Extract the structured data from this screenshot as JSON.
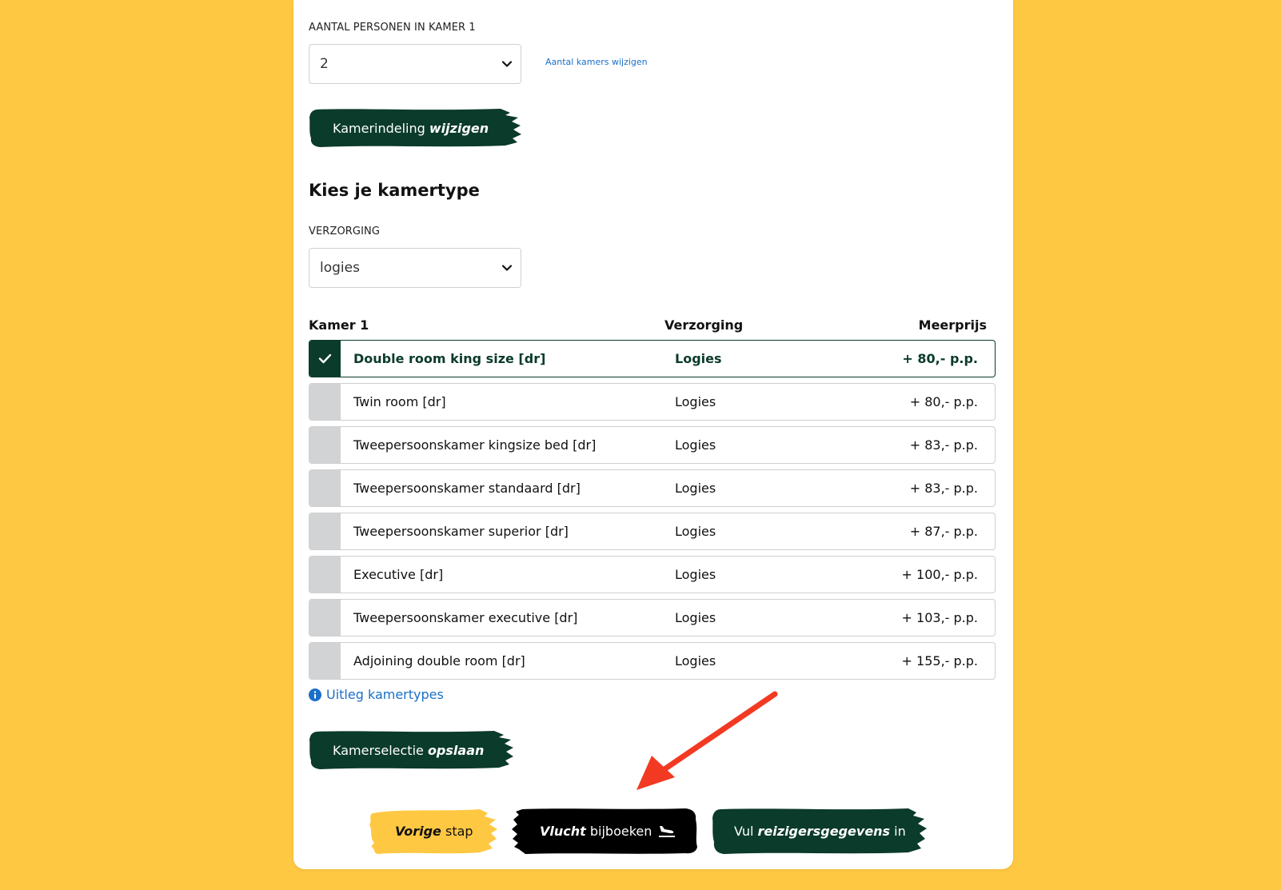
{
  "form": {
    "persons_label": "AANTAL PERSONEN IN KAMER 1",
    "persons_value": "2",
    "change_rooms_link": "Aantal kamers wijzigen",
    "layout_button_plain": "Kamerindeling ",
    "layout_button_bold": "wijzigen",
    "section_title": "Kies je kamertype",
    "care_label": "VERZORGING",
    "care_value": "logies"
  },
  "table": {
    "headers": {
      "room": "Kamer 1",
      "care": "Verzorging",
      "price": "Meerprijs"
    },
    "rows": [
      {
        "name": "Double room king size [dr]",
        "care": "Logies",
        "price": "+ 80,- p.p.",
        "selected": true
      },
      {
        "name": "Twin room [dr]",
        "care": "Logies",
        "price": "+ 80,- p.p.",
        "selected": false
      },
      {
        "name": "Tweepersoonskamer kingsize bed [dr]",
        "care": "Logies",
        "price": "+ 83,- p.p.",
        "selected": false
      },
      {
        "name": "Tweepersoonskamer standaard [dr]",
        "care": "Logies",
        "price": "+ 83,- p.p.",
        "selected": false
      },
      {
        "name": "Tweepersoonskamer superior [dr]",
        "care": "Logies",
        "price": "+ 87,- p.p.",
        "selected": false
      },
      {
        "name": "Executive [dr]",
        "care": "Logies",
        "price": "+ 100,- p.p.",
        "selected": false
      },
      {
        "name": "Tweepersoonskamer executive [dr]",
        "care": "Logies",
        "price": "+ 103,- p.p.",
        "selected": false
      },
      {
        "name": "Adjoining double room [dr]",
        "care": "Logies",
        "price": "+ 155,- p.p.",
        "selected": false
      }
    ]
  },
  "info_link": "Uitleg kamertypes",
  "save_button": {
    "plain": "Kamerselectie ",
    "bold": "opslaan"
  },
  "nav": {
    "prev": {
      "bold": "Vorige",
      "plain": " stap"
    },
    "flight": {
      "bold": "Vlucht",
      "plain": " bijboeken"
    },
    "next": {
      "plain_before": "Vul ",
      "bold": "reizigersgegevens",
      "plain_after": " in"
    }
  },
  "colors": {
    "background": "#FFC843",
    "brand_green": "#0b3b2a",
    "link_blue": "#1a6fc9",
    "annotation_arrow": "#F23A22"
  },
  "icons": [
    "chevron-down-icon",
    "check-icon",
    "info-icon",
    "plane-landing-icon",
    "annotation-arrow"
  ]
}
